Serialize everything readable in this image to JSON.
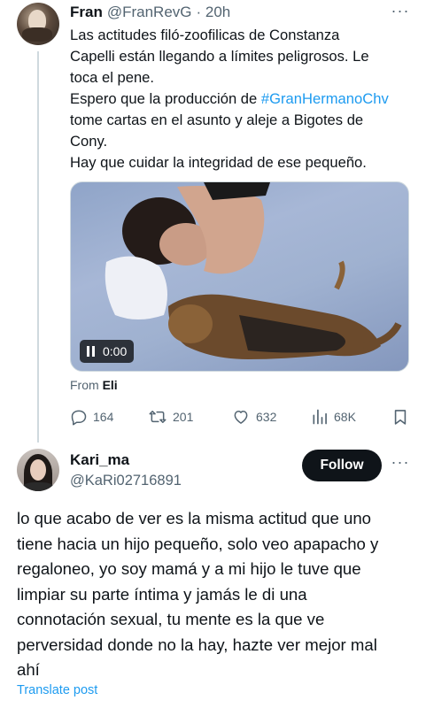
{
  "tweet": {
    "author_name": "Fran",
    "author_handle": "@FranRevG",
    "time": "· 20h",
    "lines": [
      "Las actitudes filó-zoofilicas de Constanza",
      "Capelli están llegando a límites peligrosos. Le",
      "toca el pene."
    ],
    "line4_prefix": "Espero que la producción de ",
    "hashtag": "#GranHermanoChv",
    "lines_after": [
      "tome cartas en el asunto y aleje a Bigotes de",
      "Cony.",
      "Hay que cuidar la integridad de ese pequeño."
    ],
    "video_time": "0:00",
    "from_label": "From",
    "from_name": "Eli",
    "stats": {
      "replies": "164",
      "retweets": "201",
      "likes": "632",
      "views": "68K"
    }
  },
  "reply": {
    "author_name": "Kari_ma",
    "author_handle": "@KaRi02716891",
    "follow_label": "Follow",
    "lines": [
      "lo que acabo de ver es la misma actitud que uno",
      "tiene hacia un hijo pequeño, solo veo apapacho y",
      "regaloneo, yo soy mamá y a mi hijo le tuve que",
      "limpiar su parte íntima y jamás le di una",
      "connotación sexual, tu mente es la que ve",
      "perversidad donde no la hay, hazte ver mejor mal",
      "ahí"
    ],
    "translate_label": "Translate post"
  },
  "icons": {
    "reply": "reply-icon",
    "retweet": "retweet-icon",
    "like": "heart-icon",
    "views": "views-icon",
    "bookmark": "bookmark-icon",
    "more": "more-icon",
    "pause": "pause-icon"
  },
  "colors": {
    "link": "#1d9bf0",
    "secondary_text": "#536471",
    "primary_text": "#0f1419",
    "follow_button": "#0f1419"
  }
}
